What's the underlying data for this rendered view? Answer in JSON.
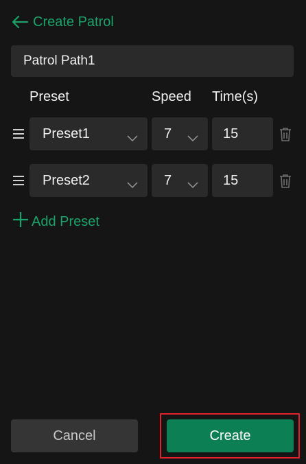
{
  "header": {
    "back_icon": "arrow-left-icon",
    "title": "Create Patrol"
  },
  "patrol": {
    "name": "Patrol Path1"
  },
  "columns": {
    "preset": "Preset",
    "speed": "Speed",
    "time": "Time(s)"
  },
  "rows": [
    {
      "preset": "Preset1",
      "speed": "7",
      "time": "15"
    },
    {
      "preset": "Preset2",
      "speed": "7",
      "time": "15"
    }
  ],
  "add_preset": {
    "icon": "plus-icon",
    "label": "Add Preset"
  },
  "actions": {
    "cancel": "Cancel",
    "create": "Create"
  },
  "colors": {
    "accent": "#1aa36a",
    "primary_button": "#0c7f55",
    "background": "#151515",
    "field": "#2a2a2a",
    "highlight": "#e0222a"
  }
}
